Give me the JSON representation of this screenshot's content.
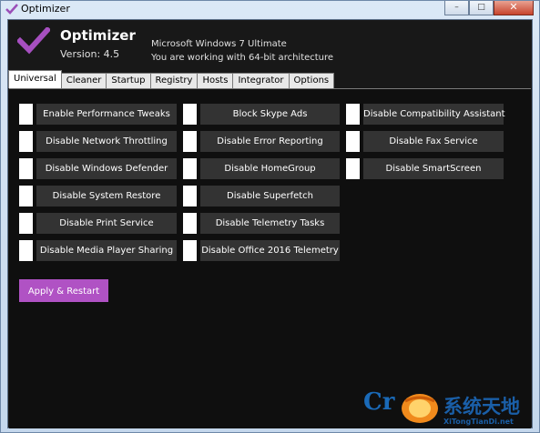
{
  "window": {
    "title": "Optimizer",
    "accent": "#b052c4",
    "minimize_glyph": "–",
    "maximize_glyph": "□",
    "close_glyph": "✕"
  },
  "header": {
    "app_name": "Optimizer",
    "version": "Version: 4.5",
    "os_line": "Microsoft Windows 7 Ultimate",
    "arch_line": "You are working with 64-bit architecture"
  },
  "tabs": [
    {
      "label": "Universal",
      "active": true
    },
    {
      "label": "Cleaner"
    },
    {
      "label": "Startup"
    },
    {
      "label": "Registry"
    },
    {
      "label": "Hosts"
    },
    {
      "label": "Integrator"
    },
    {
      "label": "Options"
    }
  ],
  "options": {
    "col1": [
      "Enable Performance Tweaks",
      "Disable Network Throttling",
      "Disable Windows Defender",
      "Disable System Restore",
      "Disable Print Service",
      "Disable Media Player Sharing"
    ],
    "col2": [
      "Block Skype Ads",
      "Disable Error Reporting",
      "Disable HomeGroup",
      "Disable Superfetch",
      "Disable Telemetry Tasks",
      "Disable Office 2016 Telemetry"
    ],
    "col3": [
      "Disable Compatibility Assistant",
      "Disable Fax Service",
      "Disable SmartScreen"
    ]
  },
  "apply_button": "Apply & Restart",
  "watermark": {
    "logo_text": "Cr",
    "chinese": "系统天地",
    "url": "XiTongTianDi.net"
  }
}
